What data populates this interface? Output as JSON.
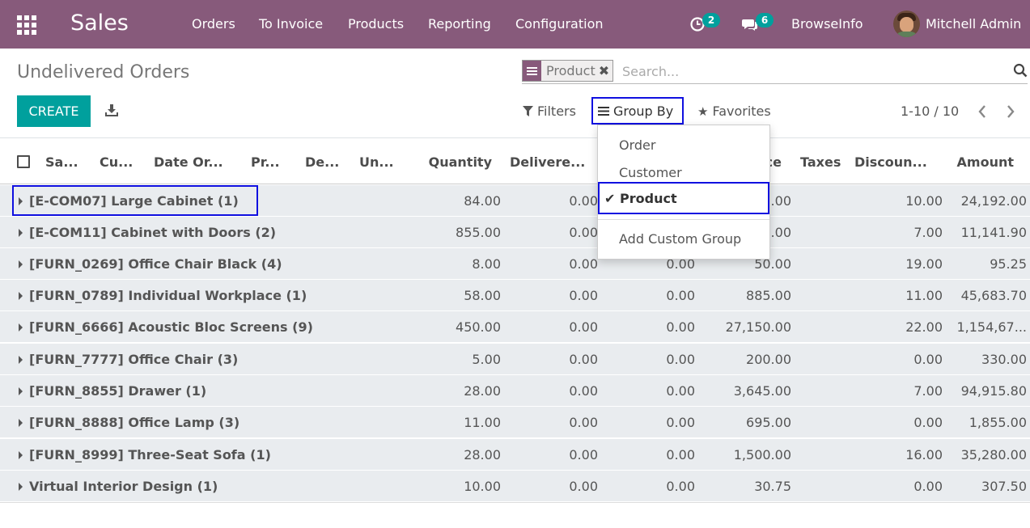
{
  "navbar": {
    "app_name": "Sales",
    "menus": [
      "Orders",
      "To Invoice",
      "Products",
      "Reporting",
      "Configuration"
    ],
    "activity_count": "2",
    "messages_count": "6",
    "company": "BrowseInfo",
    "user": "Mitchell Admin",
    "color": "#875a7b"
  },
  "control_panel": {
    "title": "Undelivered Orders",
    "search_facet": "Product",
    "search_placeholder": "Search...",
    "create_label": "CREATE",
    "filters_label": "Filters",
    "groupby_label": "Group By",
    "favorites_label": "Favorites",
    "pager": "1-10 / 10",
    "accent": "#00a09d"
  },
  "groupby_menu": {
    "items": [
      "Order",
      "Customer"
    ],
    "selected": "Product",
    "custom": "Add Custom Group"
  },
  "table": {
    "headers": [
      "Sa...",
      "Cu...",
      "Date Or...",
      "Pr...",
      "De...",
      "Un...",
      "Quantity",
      "Delivere...",
      "...ce",
      "Taxes",
      "Discoun...",
      "Amount"
    ],
    "rows": [
      {
        "name": "[E-COM07] Large Cabinet (1)",
        "quantity": "84.00",
        "delivered": "0.00",
        "invoiced": "",
        "price": ".00",
        "discount": "10.00",
        "amount": "24,192.00"
      },
      {
        "name": "[E-COM11] Cabinet with Doors (2)",
        "quantity": "855.00",
        "delivered": "0.00",
        "invoiced": "",
        "price": ".00",
        "discount": "7.00",
        "amount": "11,141.90"
      },
      {
        "name": "[FURN_0269] Office Chair Black (4)",
        "quantity": "8.00",
        "delivered": "0.00",
        "invoiced": "0.00",
        "price": "50.00",
        "discount": "19.00",
        "amount": "95.25"
      },
      {
        "name": "[FURN_0789] Individual Workplace (1)",
        "quantity": "58.00",
        "delivered": "0.00",
        "invoiced": "0.00",
        "price": "885.00",
        "discount": "11.00",
        "amount": "45,683.70"
      },
      {
        "name": "[FURN_6666] Acoustic Bloc Screens (9)",
        "quantity": "450.00",
        "delivered": "0.00",
        "invoiced": "0.00",
        "price": "27,150.00",
        "discount": "22.00",
        "amount": "1,154,67..."
      },
      {
        "name": "[FURN_7777] Office Chair (3)",
        "quantity": "5.00",
        "delivered": "0.00",
        "invoiced": "0.00",
        "price": "200.00",
        "discount": "0.00",
        "amount": "330.00"
      },
      {
        "name": "[FURN_8855] Drawer (1)",
        "quantity": "28.00",
        "delivered": "0.00",
        "invoiced": "0.00",
        "price": "3,645.00",
        "discount": "7.00",
        "amount": "94,915.80"
      },
      {
        "name": "[FURN_8888] Office Lamp (3)",
        "quantity": "11.00",
        "delivered": "0.00",
        "invoiced": "0.00",
        "price": "695.00",
        "discount": "0.00",
        "amount": "1,855.00"
      },
      {
        "name": "[FURN_8999] Three-Seat Sofa (1)",
        "quantity": "28.00",
        "delivered": "0.00",
        "invoiced": "0.00",
        "price": "1,500.00",
        "discount": "16.00",
        "amount": "35,280.00"
      },
      {
        "name": "Virtual Interior Design (1)",
        "quantity": "10.00",
        "delivered": "0.00",
        "invoiced": "0.00",
        "price": "30.75",
        "discount": "0.00",
        "amount": "307.50"
      }
    ]
  }
}
